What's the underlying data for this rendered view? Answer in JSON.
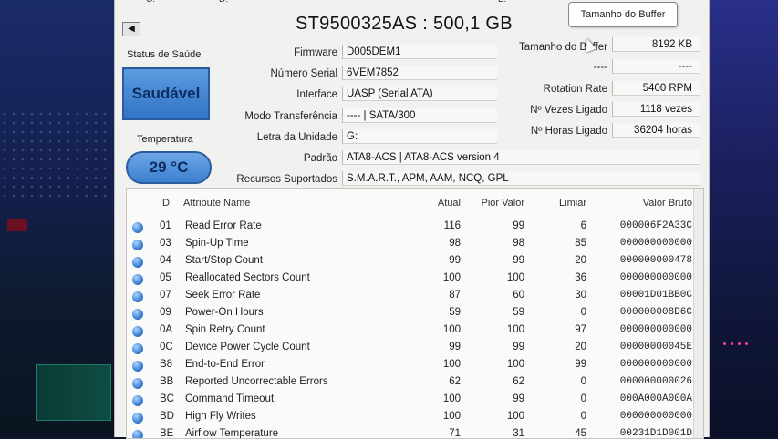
{
  "window": {
    "drive_tabs": [
      "C:",
      "D:",
      "E:"
    ],
    "title": "ST9500325AS : 500,1 GB",
    "back_label": "◀"
  },
  "health": {
    "label": "Status de Saúde",
    "status": "Saudável",
    "color": "#3d7fd0"
  },
  "temperature": {
    "label": "Temperatura",
    "value": "29 °C"
  },
  "tooltip": "Tamanho do Buffer",
  "info_left": [
    {
      "label": "Firmware",
      "value": "D005DEM1"
    },
    {
      "label": "Número Serial",
      "value": "6VEM7852"
    },
    {
      "label": "Interface",
      "value": "UASP (Serial ATA)"
    },
    {
      "label": "Modo Transferência",
      "value": "---- | SATA/300"
    },
    {
      "label": "Letra da Unidade",
      "value": "G:"
    }
  ],
  "info_right": [
    {
      "label": "Tamanho do Buffer",
      "value": "8192 KB"
    },
    {
      "label": "----",
      "value": "----"
    },
    {
      "label": "Rotation Rate",
      "value": "5400 RPM"
    },
    {
      "label": "Nº Vezes Ligado",
      "value": "1118 vezes"
    },
    {
      "label": "Nº Horas Ligado",
      "value": "36204 horas"
    }
  ],
  "standard": {
    "label": "Padrão",
    "value": "ATA8-ACS | ATA8-ACS version 4"
  },
  "features": {
    "label": "Recursos Suportados",
    "value": "S.M.A.R.T., APM, AAM, NCQ, GPL"
  },
  "table": {
    "headers": {
      "id": "ID",
      "name": "Attribute Name",
      "current": "Atual",
      "worst": "Pior Valor",
      "threshold": "Limiar",
      "raw": "Valor Bruto"
    },
    "rows": [
      {
        "id": "01",
        "name": "Read Error Rate",
        "current": "116",
        "worst": "99",
        "threshold": "6",
        "raw": "000006F2A33C"
      },
      {
        "id": "03",
        "name": "Spin-Up Time",
        "current": "98",
        "worst": "98",
        "threshold": "85",
        "raw": "000000000000"
      },
      {
        "id": "04",
        "name": "Start/Stop Count",
        "current": "99",
        "worst": "99",
        "threshold": "20",
        "raw": "000000000478"
      },
      {
        "id": "05",
        "name": "Reallocated Sectors Count",
        "current": "100",
        "worst": "100",
        "threshold": "36",
        "raw": "000000000000"
      },
      {
        "id": "07",
        "name": "Seek Error Rate",
        "current": "87",
        "worst": "60",
        "threshold": "30",
        "raw": "00001D01BB0C"
      },
      {
        "id": "09",
        "name": "Power-On Hours",
        "current": "59",
        "worst": "59",
        "threshold": "0",
        "raw": "000000008D6C"
      },
      {
        "id": "0A",
        "name": "Spin Retry Count",
        "current": "100",
        "worst": "100",
        "threshold": "97",
        "raw": "000000000000"
      },
      {
        "id": "0C",
        "name": "Device Power Cycle Count",
        "current": "99",
        "worst": "99",
        "threshold": "20",
        "raw": "00000000045E"
      },
      {
        "id": "B8",
        "name": "End-to-End Error",
        "current": "100",
        "worst": "100",
        "threshold": "99",
        "raw": "000000000000"
      },
      {
        "id": "BB",
        "name": "Reported Uncorrectable Errors",
        "current": "62",
        "worst": "62",
        "threshold": "0",
        "raw": "000000000026"
      },
      {
        "id": "BC",
        "name": "Command Timeout",
        "current": "100",
        "worst": "99",
        "threshold": "0",
        "raw": "000A000A000A"
      },
      {
        "id": "BD",
        "name": "High Fly Writes",
        "current": "100",
        "worst": "100",
        "threshold": "0",
        "raw": "000000000000"
      },
      {
        "id": "BE",
        "name": "Airflow Temperature",
        "current": "71",
        "worst": "31",
        "threshold": "45",
        "raw": "00231D1D001D"
      }
    ]
  }
}
